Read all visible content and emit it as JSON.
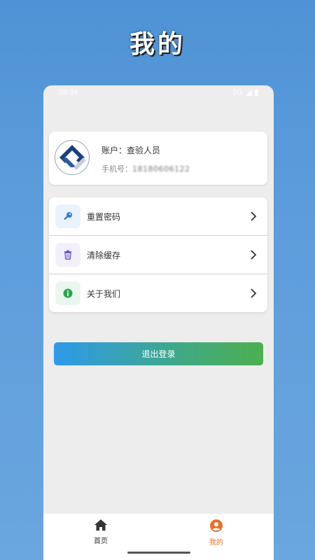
{
  "page_title": "我的",
  "status_bar": {
    "time": "09:34",
    "network": "5G"
  },
  "profile": {
    "account_label": "账户：",
    "account_value": "查验人员",
    "phone_label": "手机号：",
    "phone_value": "18180606122"
  },
  "menu": [
    {
      "label": "重置密码",
      "icon": "key-icon",
      "color": "#2f7bdc",
      "bg": "#eaf3fd"
    },
    {
      "label": "清除缓存",
      "icon": "trash-icon",
      "color": "#6a5acd",
      "bg": "#f4f0fb"
    },
    {
      "label": "关于我们",
      "icon": "info-icon",
      "color": "#28a84a",
      "bg": "#eaf7ee"
    }
  ],
  "logout_label": "退出登录",
  "tabs": [
    {
      "label": "首页",
      "icon": "home-icon",
      "active": false
    },
    {
      "label": "我的",
      "icon": "user-icon",
      "active": true
    }
  ],
  "colors": {
    "accent": "#e8702a",
    "inactive": "#333333",
    "btn_start": "#2e9aea",
    "btn_end": "#4caf50"
  }
}
